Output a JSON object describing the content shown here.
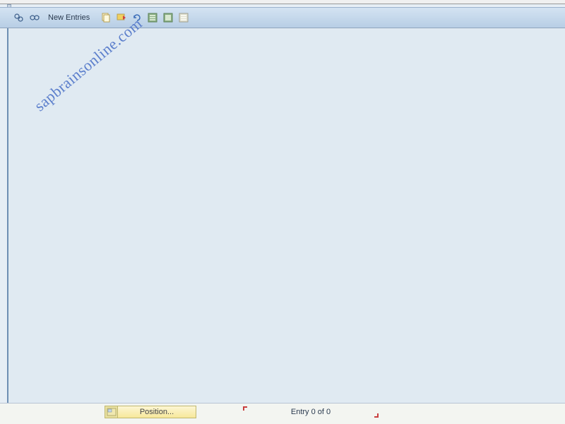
{
  "toolbar": {
    "new_entries_label": "New Entries"
  },
  "watermark": {
    "text": "sapbrainsonline.com"
  },
  "footer": {
    "position_button_label": "Position...",
    "entry_text": "Entry 0 of 0"
  }
}
